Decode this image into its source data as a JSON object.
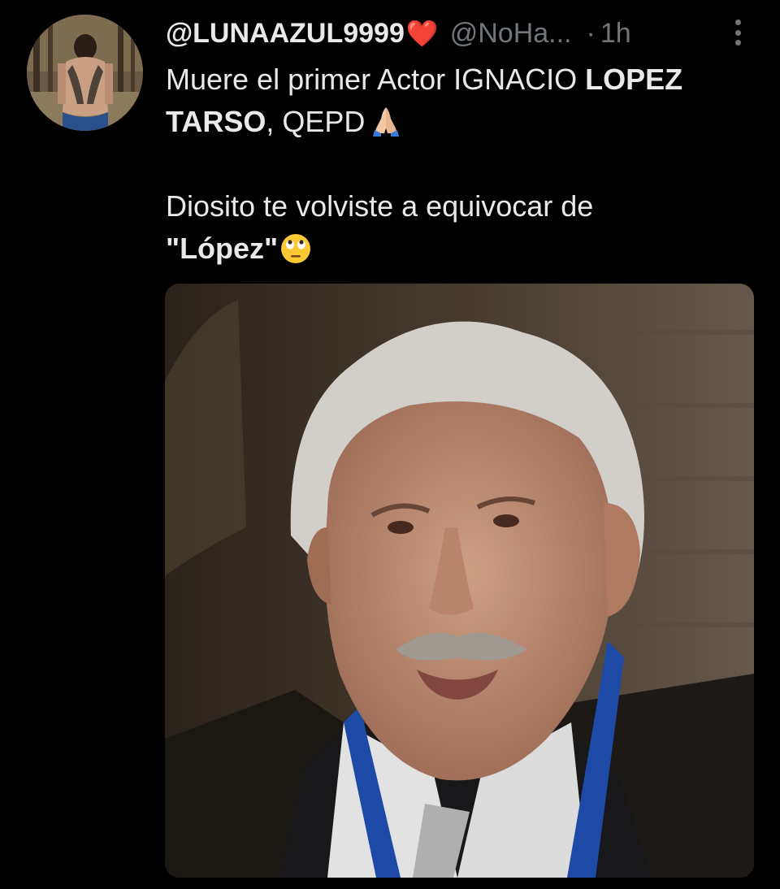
{
  "tweet": {
    "author": {
      "username": "@LUNAAZUL9999",
      "username_emoji": "❤️",
      "handle": "@NoHa...",
      "separator": "·",
      "time": "1h"
    },
    "text": {
      "line1_prefix": "Muere el primer Actor IGNACIO ",
      "line1_bold": "LOPEZ",
      "line2_bold": "TARSO",
      "line2_suffix": ", QEPD",
      "line3": "Diosito te volviste a equivocar de",
      "line4_bold": "\"López\""
    },
    "icons": {
      "more": "more-vertical-icon",
      "heart": "red-heart-emoji",
      "hands": "folded-hands-emoji",
      "face": "face-with-rolling-eyes-emoji"
    },
    "colors": {
      "background": "#000000",
      "text": "#e7e9ea",
      "secondary": "#71767b",
      "heart": "#f4212e"
    }
  }
}
